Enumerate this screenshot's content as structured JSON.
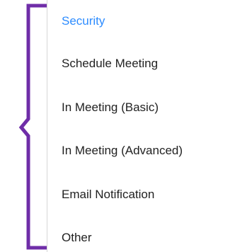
{
  "colors": {
    "accent": "#2D8CFF",
    "text": "#222222",
    "brace": "#6F2DA8",
    "divider": "#d6d6d6"
  },
  "annotation": {
    "shape": "curly-brace",
    "color": "#6F2DA8"
  },
  "menu": {
    "items": [
      {
        "label": "Security",
        "active": true
      },
      {
        "label": "Schedule Meeting",
        "active": false
      },
      {
        "label": "In Meeting (Basic)",
        "active": false
      },
      {
        "label": "In Meeting (Advanced)",
        "active": false
      },
      {
        "label": "Email Notification",
        "active": false
      },
      {
        "label": "Other",
        "active": false
      }
    ]
  }
}
